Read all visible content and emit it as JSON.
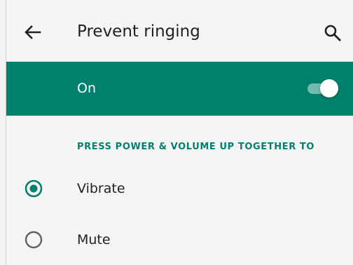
{
  "appbar": {
    "title": "Prevent ringing",
    "back_icon": "arrow-back-icon",
    "search_icon": "search-icon"
  },
  "master_switch": {
    "label": "On",
    "state": "on"
  },
  "section": {
    "header": "PRESS POWER & VOLUME UP TOGETHER TO"
  },
  "options": [
    {
      "label": "Vibrate",
      "selected": true
    },
    {
      "label": "Mute",
      "selected": false
    }
  ],
  "colors": {
    "accent": "#00816d",
    "background": "#f5f5f5",
    "text": "#202124",
    "radio_unselected": "#5f6368"
  }
}
